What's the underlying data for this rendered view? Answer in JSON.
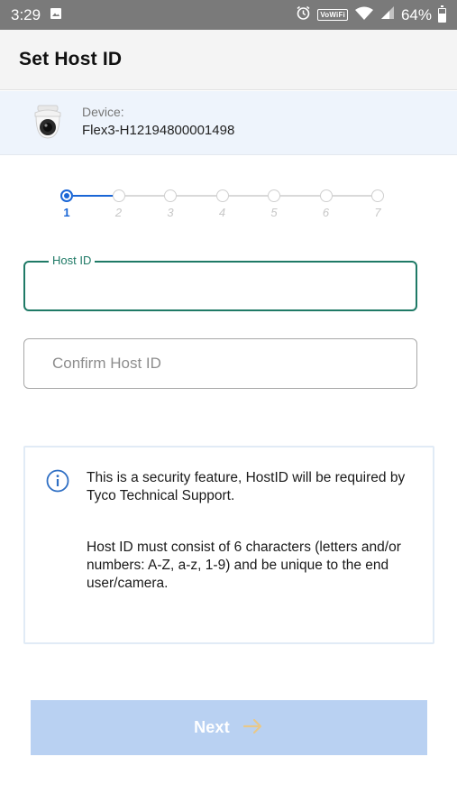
{
  "status_bar": {
    "time": "3:29",
    "vowifi": "VoWiFi",
    "battery_percent": "64%",
    "battery_level": 0.64,
    "icons": [
      "image-icon",
      "alarm-icon",
      "wifi-icon",
      "signal-icon",
      "battery-icon"
    ]
  },
  "app_bar": {
    "title": "Set Host ID"
  },
  "device": {
    "label": "Device:",
    "name": "Flex3-H12194800001498",
    "icon": "dome-camera-icon"
  },
  "stepper": {
    "steps": [
      "1",
      "2",
      "3",
      "4",
      "5",
      "6",
      "7"
    ],
    "current_step": 1,
    "accent": "#1a66d6",
    "inactive_color": "#cfcfcf"
  },
  "form": {
    "host_id": {
      "label": "Host ID",
      "value": ""
    },
    "confirm_host_id": {
      "placeholder": "Confirm Host ID",
      "value": ""
    }
  },
  "info": {
    "icon": "info-icon",
    "paragraph1": "This is a security feature, HostID will be required by Tyco Technical Support.",
    "paragraph2": "Host ID must consist of 6 characters (letters and/or numbers: A-Z, a-z, 1-9) and be unique to the end user/camera."
  },
  "next_button": {
    "label": "Next",
    "icon": "arrow-right-icon",
    "background": "#b9d1f2",
    "arrow_color": "#e8c88a"
  },
  "colors": {
    "status_bar": "#7a7a7a",
    "app_bar": "#f4f4f4",
    "device_band": "#eef4fc",
    "field_focus": "#1f7a66",
    "info_border": "#e1ebf6"
  }
}
